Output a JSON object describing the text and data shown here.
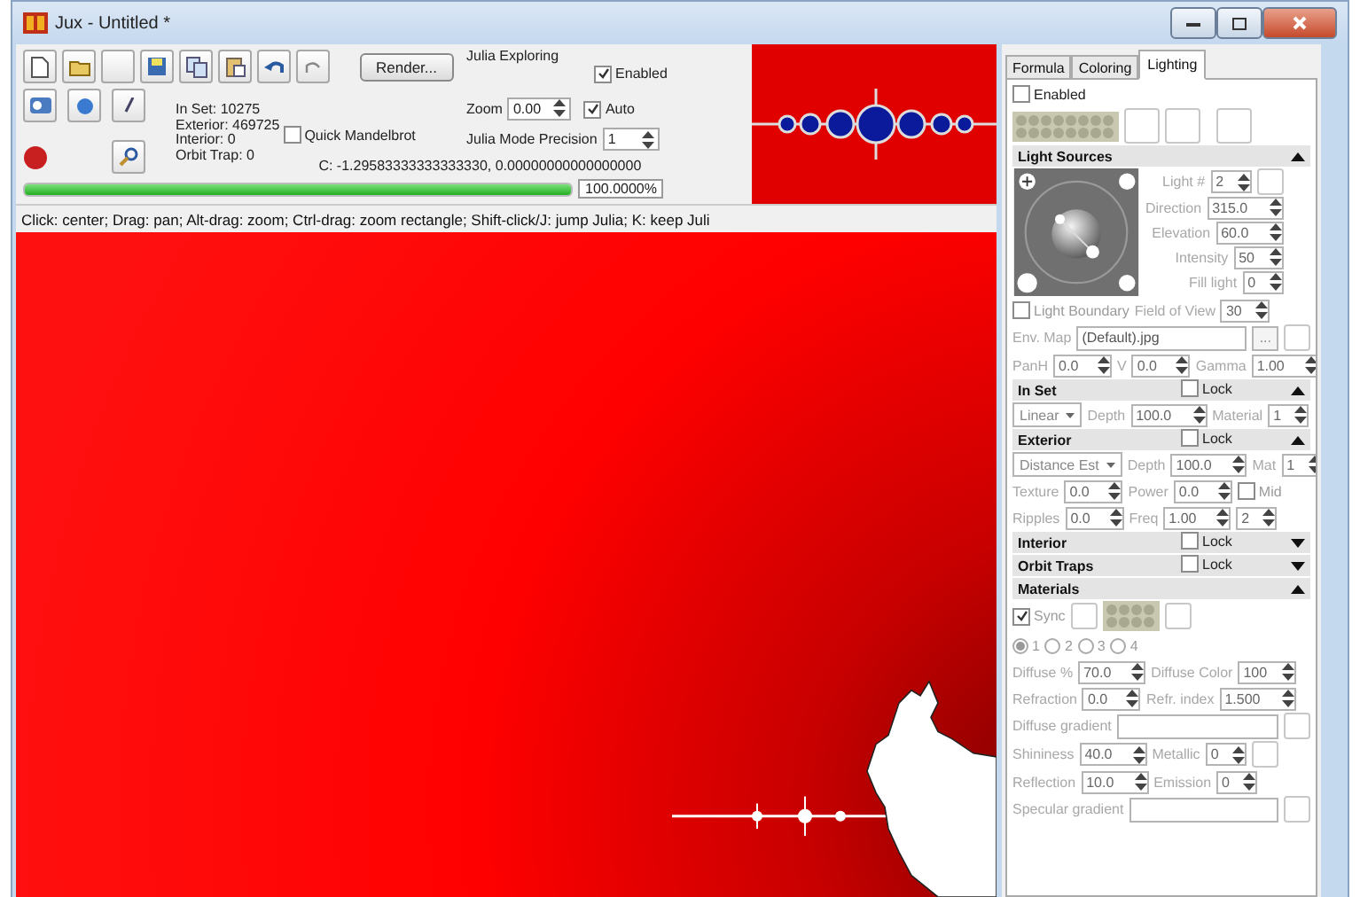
{
  "window": {
    "title": "Jux - Untitled *"
  },
  "toolbar": {
    "render_button": "Render...",
    "stats": [
      "In Set: 10275",
      "Exterior: 469725",
      "Interior: 0",
      "Orbit Trap: 0"
    ],
    "quick_mandelbrot": {
      "label": "Quick Mandelbrot",
      "checked": false
    },
    "c_value": "C: -1.29583333333333330, 0.00000000000000000"
  },
  "julia": {
    "title": "Julia Exploring",
    "enabled": {
      "label": "Enabled",
      "checked": true
    },
    "zoom": {
      "label": "Zoom",
      "value": "0.00"
    },
    "auto": {
      "label": "Auto",
      "checked": true
    },
    "precision": {
      "label": "Julia Mode Precision",
      "value": "1"
    }
  },
  "progress": {
    "level": 1.0,
    "reading": "100.0000%"
  },
  "hint": "Click: center; Drag: pan; Alt-drag: zoom; Ctrl-drag: zoom rectangle; Shift-click/J: jump Julia; K: keep Juli",
  "panel": {
    "dimmed": true,
    "tabs": [
      {
        "label": "Formula",
        "selected": false
      },
      {
        "label": "Coloring",
        "selected": false
      },
      {
        "label": "Lighting",
        "selected": true
      }
    ],
    "enabled": {
      "label": "Enabled",
      "checked": false
    },
    "sections": [
      {
        "title": "Light Sources",
        "expanded": true,
        "rows": [
          {
            "items": [
              {
                "kind": "pad",
                "rows": [
                  {
                    "items": [
                      {
                        "kind": "label",
                        "text": "Light #"
                      },
                      {
                        "kind": "spin",
                        "value": "2"
                      },
                      {
                        "kind": "swatch"
                      }
                    ]
                  },
                  {
                    "items": [
                      {
                        "kind": "label",
                        "text": "Direction"
                      },
                      {
                        "kind": "spin",
                        "value": "315.0"
                      }
                    ]
                  },
                  {
                    "items": [
                      {
                        "kind": "label",
                        "text": "Elevation"
                      },
                      {
                        "kind": "spin",
                        "value": "60.0"
                      }
                    ]
                  },
                  {
                    "items": [
                      {
                        "kind": "label",
                        "text": "Intensity"
                      },
                      {
                        "kind": "spin",
                        "value": "50"
                      }
                    ]
                  },
                  {
                    "items": [
                      {
                        "kind": "label",
                        "text": "Fill light"
                      },
                      {
                        "kind": "spin",
                        "value": "0"
                      }
                    ]
                  }
                ]
              }
            ]
          },
          {
            "items": [
              {
                "kind": "check",
                "label": "Light Boundary",
                "checked": false
              },
              {
                "kind": "label",
                "text": "Field of View"
              },
              {
                "kind": "spin",
                "value": "30"
              }
            ]
          },
          {
            "items": [
              {
                "kind": "label",
                "text": "Env. Map"
              },
              {
                "kind": "text",
                "value": "(Default).jpg"
              },
              {
                "kind": "button",
                "label": "..."
              },
              {
                "kind": "swatch"
              }
            ]
          },
          {
            "items": [
              {
                "kind": "label",
                "text": "PanH"
              },
              {
                "kind": "spin",
                "value": "0.0"
              },
              {
                "kind": "label",
                "text": "V"
              },
              {
                "kind": "spin",
                "value": "0.0"
              },
              {
                "kind": "label",
                "text": "Gamma"
              },
              {
                "kind": "spin",
                "value": "1.00"
              }
            ]
          }
        ]
      },
      {
        "title": "In Set",
        "lock": {
          "label": "Lock",
          "checked": false
        },
        "expanded": true,
        "rows": [
          {
            "items": [
              {
                "kind": "select",
                "value": "Linear"
              },
              {
                "kind": "label",
                "text": "Depth"
              },
              {
                "kind": "spin",
                "value": "100.0"
              },
              {
                "kind": "label",
                "text": "Material"
              },
              {
                "kind": "spin",
                "value": "1"
              }
            ]
          }
        ]
      },
      {
        "title": "Exterior",
        "lock": {
          "label": "Lock",
          "checked": false
        },
        "expanded": true,
        "rows": [
          {
            "items": [
              {
                "kind": "select",
                "value": "Distance Est"
              },
              {
                "kind": "label",
                "text": "Depth"
              },
              {
                "kind": "spin",
                "value": "100.0"
              },
              {
                "kind": "label",
                "text": "Mat"
              },
              {
                "kind": "spin",
                "value": "1"
              }
            ]
          },
          {
            "items": [
              {
                "kind": "label",
                "text": "Texture"
              },
              {
                "kind": "spin",
                "value": "0.0"
              },
              {
                "kind": "label",
                "text": "Power"
              },
              {
                "kind": "spin",
                "value": "0.0"
              },
              {
                "kind": "check",
                "label": "Mid",
                "checked": false
              }
            ]
          },
          {
            "items": [
              {
                "kind": "label",
                "text": "Ripples"
              },
              {
                "kind": "spin",
                "value": "0.0"
              },
              {
                "kind": "label",
                "text": "Freq"
              },
              {
                "kind": "spin",
                "value": "1.00"
              },
              {
                "kind": "spin",
                "value": "2"
              }
            ]
          }
        ]
      },
      {
        "title": "Interior",
        "lock": {
          "label": "Lock",
          "checked": false
        },
        "expanded": false
      },
      {
        "title": "Orbit Traps",
        "lock": {
          "label": "Lock",
          "checked": false
        },
        "expanded": false
      },
      {
        "title": "Materials",
        "expanded": true,
        "rows": [
          {
            "items": [
              {
                "kind": "check",
                "label": "Sync",
                "checked": true
              },
              {
                "kind": "swatch"
              },
              {
                "kind": "palette"
              },
              {
                "kind": "swatch"
              }
            ]
          },
          {
            "items": [
              {
                "kind": "radio",
                "label": "1",
                "selected": true
              },
              {
                "kind": "radio",
                "label": "2",
                "selected": false
              },
              {
                "kind": "radio",
                "label": "3",
                "selected": false
              },
              {
                "kind": "radio",
                "label": "4",
                "selected": false
              }
            ]
          },
          {
            "items": [
              {
                "kind": "label",
                "text": "Diffuse %"
              },
              {
                "kind": "spin",
                "value": "70.0"
              },
              {
                "kind": "label",
                "text": "Diffuse Color"
              },
              {
                "kind": "spin",
                "value": "100"
              }
            ]
          },
          {
            "items": [
              {
                "kind": "label",
                "text": "Refraction"
              },
              {
                "kind": "spin",
                "value": "0.0"
              },
              {
                "kind": "label",
                "text": "Refr. index"
              },
              {
                "kind": "spin",
                "value": "1.500"
              }
            ]
          },
          {
            "items": [
              {
                "kind": "label",
                "text": "Diffuse gradient"
              },
              {
                "kind": "text"
              },
              {
                "kind": "swatch"
              }
            ]
          },
          {
            "items": [
              {
                "kind": "label",
                "text": "Shininess"
              },
              {
                "kind": "spin",
                "value": "40.0"
              },
              {
                "kind": "label",
                "text": "Metallic"
              },
              {
                "kind": "spin",
                "value": "0"
              },
              {
                "kind": "swatch"
              }
            ]
          },
          {
            "items": [
              {
                "kind": "label",
                "text": "Reflection"
              },
              {
                "kind": "spin",
                "value": "10.0"
              },
              {
                "kind": "label",
                "text": "Emission"
              },
              {
                "kind": "spin",
                "value": "0"
              }
            ]
          },
          {
            "items": [
              {
                "kind": "label",
                "text": "Specular gradient"
              },
              {
                "kind": "text"
              },
              {
                "kind": "swatch"
              }
            ]
          }
        ]
      }
    ]
  }
}
